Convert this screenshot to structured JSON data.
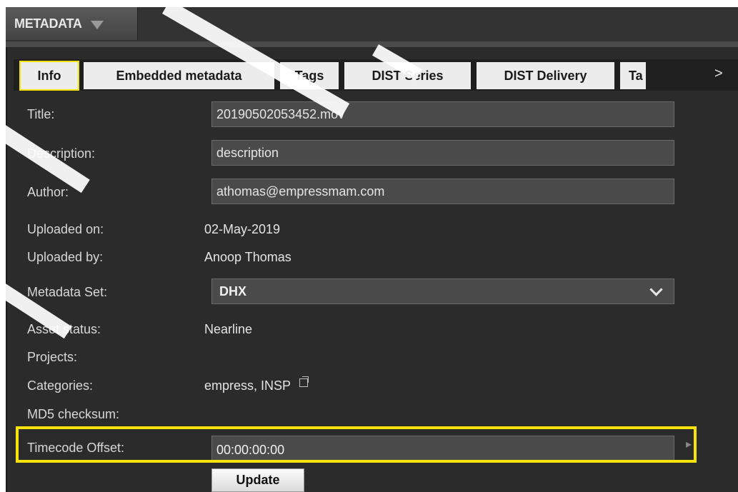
{
  "panel": {
    "title": "METADATA"
  },
  "tabs": [
    {
      "label": "Info",
      "active": true
    },
    {
      "label": "Embedded metadata"
    },
    {
      "label": "Tags"
    },
    {
      "label": "DIST Series"
    },
    {
      "label": "DIST Delivery"
    },
    {
      "label": "Ta"
    }
  ],
  "tabs_more": ">",
  "fields": {
    "title": {
      "label": "Title:",
      "value": "20190502053452.mov"
    },
    "description": {
      "label": "Description:",
      "value": "description"
    },
    "author": {
      "label": "Author:",
      "value": "athomas@empressmam.com"
    },
    "uploaded_on": {
      "label": "Uploaded on:",
      "value": "02-May-2019"
    },
    "uploaded_by": {
      "label": "Uploaded by:",
      "value": "Anoop Thomas"
    },
    "metadata_set": {
      "label": "Metadata Set:",
      "value": "DHX"
    },
    "asset_status": {
      "label": "Asset status:",
      "value": "Nearline"
    },
    "projects": {
      "label": "Projects:"
    },
    "categories": {
      "label": "Categories:",
      "value": "empress, INSP"
    },
    "md5": {
      "label": "MD5 checksum:"
    },
    "timecode_offset": {
      "label": "Timecode Offset:",
      "value": "00:00:00:00"
    }
  },
  "update_label": "Update",
  "icons": {
    "panel_menu": "chevron-down-icon",
    "select": "chevron-down-icon",
    "categories_open": "external-window-icon"
  },
  "colors": {
    "highlight": "#f5e30a",
    "panel_bg": "#2b2b2b",
    "field_bg": "#4a4a4a"
  }
}
